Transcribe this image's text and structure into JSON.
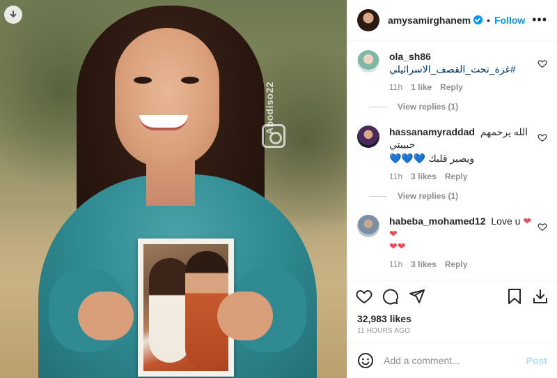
{
  "post": {
    "watermark": "Abodiso22",
    "author": "amysamirghanem",
    "follow_label": "Follow",
    "dot": "•",
    "more": "•••"
  },
  "comments": [
    {
      "user": "ola_sh86",
      "text": "#غزة_تحت_القصف_الاسرائيلي",
      "time": "11h",
      "likes": "1 like",
      "reply": "Reply",
      "view_replies": "View replies (1)"
    },
    {
      "user": "hassanamyraddad",
      "text": "الله يرحمهم حبيبتي",
      "text2": "ويصبر قلبك",
      "hearts": "💙💙💙",
      "time": "11h",
      "likes": "3 likes",
      "reply": "Reply",
      "view_replies": "View replies (1)"
    },
    {
      "user": "habeba_mohamed12",
      "text": "Love u",
      "hearts": "❤❤",
      "hearts2": "❤❤",
      "time": "11h",
      "likes": "3 likes",
      "reply": "Reply"
    }
  ],
  "stats": {
    "likes": "32,983 likes",
    "time": "11 HOURS AGO"
  },
  "add_comment": {
    "placeholder": "Add a comment...",
    "post_label": "Post"
  },
  "colors": {
    "accent": "#0095f6",
    "heart": "#ed4956",
    "post_disabled": "#b2dffc"
  },
  "icons": [
    "download-icon",
    "verified-badge-icon",
    "more-icon",
    "like-icon",
    "comment-icon",
    "share-icon",
    "save-icon",
    "download-icon",
    "emoji-icon"
  ]
}
